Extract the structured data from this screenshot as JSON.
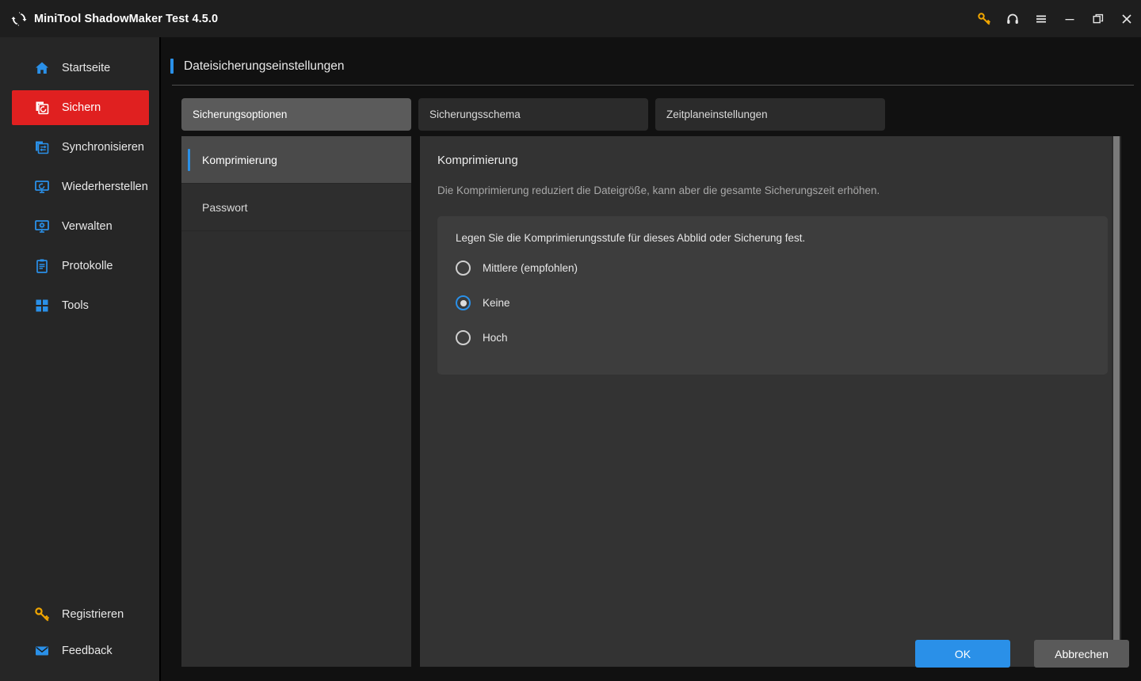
{
  "window": {
    "title": "MiniTool ShadowMaker Test 4.5.0",
    "logo_icon": "shadowmaker-logo-icon",
    "controls": [
      {
        "name": "key-icon",
        "glyph": "key"
      },
      {
        "name": "headset-icon",
        "glyph": "headset"
      },
      {
        "name": "hamburger-menu-icon",
        "glyph": "menu"
      },
      {
        "name": "minimize-icon",
        "glyph": "minimize"
      },
      {
        "name": "restore-icon",
        "glyph": "restore"
      },
      {
        "name": "close-icon",
        "glyph": "close"
      }
    ]
  },
  "sidebar": {
    "items": [
      {
        "label": "Startseite",
        "icon": "home-icon",
        "active": false
      },
      {
        "label": "Sichern",
        "icon": "backup-icon",
        "active": true
      },
      {
        "label": "Synchronisieren",
        "icon": "sync-icon",
        "active": false
      },
      {
        "label": "Wiederherstellen",
        "icon": "restore-monitor-icon",
        "active": false
      },
      {
        "label": "Verwalten",
        "icon": "manage-gear-icon",
        "active": false
      },
      {
        "label": "Protokolle",
        "icon": "logs-clipboard-icon",
        "active": false
      },
      {
        "label": "Tools",
        "icon": "tools-grid-icon",
        "active": false
      }
    ],
    "bottom_items": [
      {
        "label": "Registrieren",
        "icon": "key-icon"
      },
      {
        "label": "Feedback",
        "icon": "mail-icon"
      }
    ]
  },
  "page": {
    "title": "Dateisicherungseinstellungen",
    "accent_color": "#2a90e8"
  },
  "tabs": [
    {
      "label": "Sicherungsoptionen",
      "active": true
    },
    {
      "label": "Sicherungsschema",
      "active": false
    },
    {
      "label": "Zeitplaneinstellungen",
      "active": false
    }
  ],
  "subnav": [
    {
      "label": "Komprimierung",
      "active": true
    },
    {
      "label": "Passwort",
      "active": false
    }
  ],
  "content": {
    "title": "Komprimierung",
    "description": "Die Komprimierung reduziert die Dateigröße, kann aber die gesamte Sicherungszeit erhöhen.",
    "card": {
      "prompt": "Legen Sie die Komprimierungsstufe für dieses Abblid oder Sicherung fest.",
      "options": [
        {
          "label": "Mittlere (empfohlen)",
          "selected": false
        },
        {
          "label": "Keine",
          "selected": true
        },
        {
          "label": "Hoch",
          "selected": false
        }
      ]
    }
  },
  "footer": {
    "ok_label": "OK",
    "cancel_label": "Abbrechen",
    "ok_color": "#2a90e8"
  }
}
